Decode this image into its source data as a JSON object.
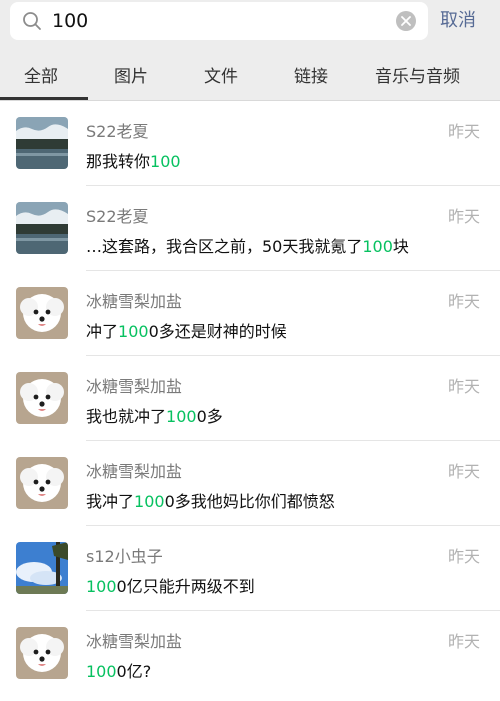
{
  "search": {
    "query": "100",
    "cancel_label": "取消"
  },
  "tabs": [
    {
      "label": "全部",
      "active": true
    },
    {
      "label": "图片"
    },
    {
      "label": "文件"
    },
    {
      "label": "链接"
    },
    {
      "label": "音乐与音频"
    }
  ],
  "results": [
    {
      "name": "S22老夏",
      "time": "昨天",
      "avatar": "landscape-lake",
      "msg_pre": "那我转你",
      "msg_hl": "100",
      "msg_post": ""
    },
    {
      "name": "S22老夏",
      "time": "昨天",
      "avatar": "landscape-lake",
      "msg_pre": "…这套路，我合区之前，50天我就氪了",
      "msg_hl": "100",
      "msg_post": "块"
    },
    {
      "name": "冰糖雪梨加盐",
      "time": "昨天",
      "avatar": "white-dog",
      "msg_pre": "冲了",
      "msg_hl": "100",
      "msg_post": "0多还是财神的时候"
    },
    {
      "name": "冰糖雪梨加盐",
      "time": "昨天",
      "avatar": "white-dog",
      "msg_pre": "我也就冲了",
      "msg_hl": "100",
      "msg_post": "0多"
    },
    {
      "name": "冰糖雪梨加盐",
      "time": "昨天",
      "avatar": "white-dog",
      "msg_pre": "我冲了",
      "msg_hl": "100",
      "msg_post": "0多我他妈比你们都愤怒"
    },
    {
      "name": "s12小虫子",
      "time": "昨天",
      "avatar": "sky-tree",
      "msg_pre": "",
      "msg_hl": "100",
      "msg_post": "0亿只能升两级不到"
    },
    {
      "name": "冰糖雪梨加盐",
      "time": "昨天",
      "avatar": "white-dog",
      "msg_pre": "",
      "msg_hl": "100",
      "msg_post": "0亿?"
    }
  ],
  "colors": {
    "highlight": "#07c160",
    "link": "#576b95",
    "background": "#ededed"
  }
}
